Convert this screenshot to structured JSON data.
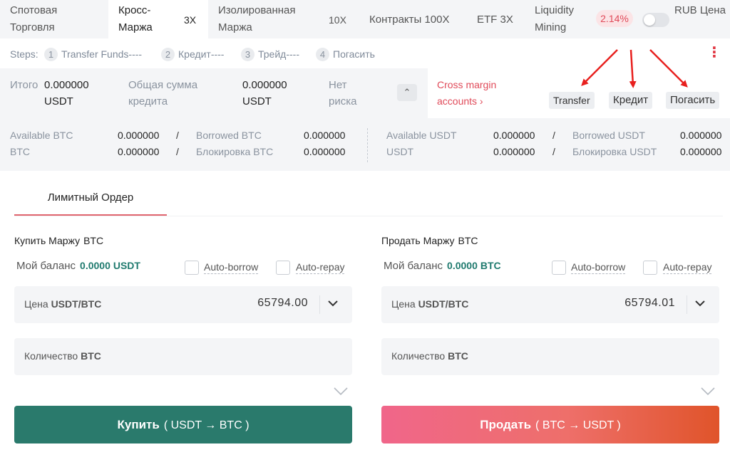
{
  "tabs": {
    "spot": [
      "Спотовая",
      "Торговля"
    ],
    "cross": [
      "Кросс-",
      "Маржа"
    ],
    "cross_mult": "3X",
    "isolated": [
      "Изолированная",
      "Маржа"
    ],
    "isolated_mult": "10X",
    "contracts": "Контракты 100X",
    "etf": "ETF 3X",
    "liquidity": [
      "Liquidity",
      "Mining"
    ],
    "rate": "2.14%",
    "rub": [
      "RUB",
      "Цена"
    ]
  },
  "steps": {
    "label": "Steps:",
    "items": [
      {
        "num": "1",
        "label": "Transfer Funds----"
      },
      {
        "num": "2",
        "label": "Кредит----"
      },
      {
        "num": "3",
        "label": "Трейд----"
      },
      {
        "num": "4",
        "label": "Погасить"
      }
    ],
    "more": "⋮"
  },
  "summary": {
    "total_label": "Итого",
    "total_value": "0.000000",
    "total_unit": "USDT",
    "credit_label": [
      "Общая сумма",
      "кредита"
    ],
    "credit_value": "0.000000",
    "credit_unit": "USDT",
    "risk_label": [
      "Нет",
      "риска"
    ],
    "collapse_icon": "⌃",
    "cross_link": [
      "Cross margin",
      "accounts ›"
    ],
    "transfer": "Transfer",
    "credit_btn": "Кредит",
    "repay_btn": "Погасить"
  },
  "balances": {
    "btc": {
      "available_label": "Available BTC",
      "available_value": "0.000000",
      "borrowed_label": "Borrowed BTC",
      "borrowed_value": "0.000000",
      "total_label": "BTC",
      "total_value": "0.000000",
      "locked_label": "Блокировка BTC",
      "locked_value": "0.000000"
    },
    "usdt": {
      "available_label": "Available USDT",
      "available_value": "0.000000",
      "borrowed_label": "Borrowed USDT",
      "borrowed_value": "0.000000",
      "total_label": "USDT",
      "total_value": "0.000000",
      "locked_label": "Блокировка USDT",
      "locked_value": "0.000000"
    },
    "slash": "/"
  },
  "order": {
    "tab": "Лимитный Ордер",
    "buy": {
      "title": "Купить Маржу",
      "coin": "BTC",
      "balance_label": "Мой баланс",
      "balance_value": "0.0000",
      "balance_unit": "USDT",
      "auto_borrow": "Auto-borrow",
      "auto_repay": "Auto-repay",
      "price_label": "Цена",
      "price_unit": "USDT/BTC",
      "price_value": "65794.00",
      "qty_label": "Количество",
      "qty_unit": "BTC",
      "button": "Купить",
      "button_sub": "( USDT → BTC )"
    },
    "sell": {
      "title": "Продать Маржу",
      "coin": "BTC",
      "balance_label": "Мой баланс",
      "balance_value": "0.0000",
      "balance_unit": "BTC",
      "auto_borrow": "Auto-borrow",
      "auto_repay": "Auto-repay",
      "price_label": "Цена",
      "price_unit": "USDT/BTC",
      "price_value": "65794.01",
      "qty_label": "Количество",
      "qty_unit": "BTC",
      "button": "Продать",
      "button_sub": "( BTC → USDT )"
    }
  },
  "icons": {
    "chevron_down": "⌄",
    "arrow_color": "#e8201e",
    "buy_color": "#2a7a6c",
    "sell_color": "#ee6f6a"
  }
}
